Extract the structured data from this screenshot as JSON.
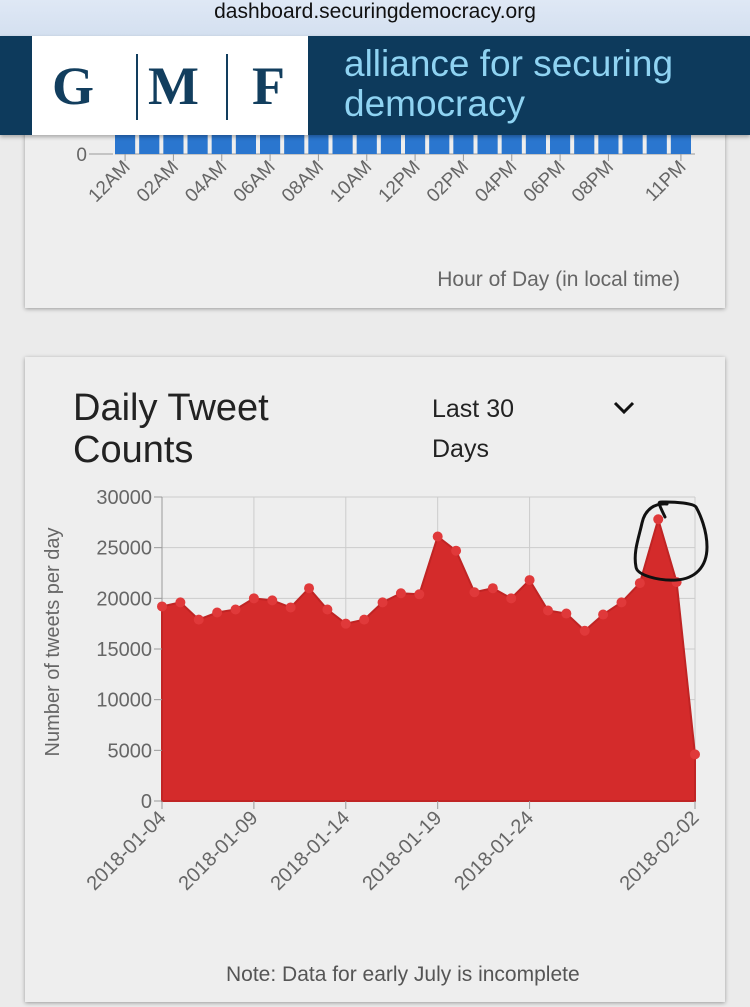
{
  "browser": {
    "url": "dashboard.securingdemocracy.org"
  },
  "header": {
    "logo_letters": [
      "G",
      "M",
      "F"
    ],
    "org_name": "alliance for securing democracy"
  },
  "hourly_card": {
    "y_tick_zero": "0",
    "x_ticks": [
      "12AM",
      "02AM",
      "04AM",
      "06AM",
      "08AM",
      "10AM",
      "12PM",
      "02PM",
      "04PM",
      "06PM",
      "08PM",
      "11PM"
    ],
    "xlabel": "Hour of Day (in local time)"
  },
  "daily_card": {
    "title": "Daily Tweet Counts",
    "range_select": "Last 30 Days",
    "note": "Note: Data for early July is incomplete"
  },
  "colors": {
    "area": "#d42b2b",
    "point": "#e0393a",
    "header_bg": "#0d3a5c",
    "org_text": "#8fd3f2",
    "hourly_bar": "#2a76cf"
  },
  "chart_data": {
    "type": "area",
    "title": "Daily Tweet Counts",
    "ylabel": "Number of tweets per day",
    "xlabel": "",
    "ylim": [
      0,
      30000
    ],
    "yticks": [
      0,
      5000,
      10000,
      15000,
      20000,
      25000,
      30000
    ],
    "xtick_labels": [
      "2018-01-04",
      "2018-01-09",
      "2018-01-14",
      "2018-01-19",
      "2018-01-24",
      "2018-02-02"
    ],
    "grid": true,
    "x": [
      "2018-01-04",
      "2018-01-05",
      "2018-01-06",
      "2018-01-07",
      "2018-01-08",
      "2018-01-09",
      "2018-01-10",
      "2018-01-11",
      "2018-01-12",
      "2018-01-13",
      "2018-01-14",
      "2018-01-15",
      "2018-01-16",
      "2018-01-17",
      "2018-01-18",
      "2018-01-19",
      "2018-01-20",
      "2018-01-21",
      "2018-01-22",
      "2018-01-23",
      "2018-01-24",
      "2018-01-25",
      "2018-01-26",
      "2018-01-27",
      "2018-01-28",
      "2018-01-29",
      "2018-01-30",
      "2018-01-31",
      "2018-02-01",
      "2018-02-02"
    ],
    "values": [
      19200,
      19600,
      17900,
      18600,
      18900,
      20000,
      19800,
      19100,
      21000,
      18900,
      17500,
      17900,
      19600,
      20500,
      20400,
      26100,
      24700,
      20600,
      21000,
      20000,
      21800,
      18800,
      18500,
      16800,
      18400,
      19600,
      21500,
      27800,
      21600,
      4600
    ]
  }
}
